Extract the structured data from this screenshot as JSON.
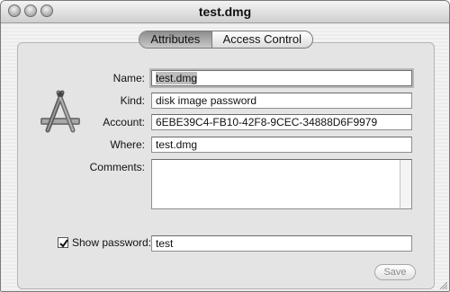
{
  "window": {
    "title": "test.dmg"
  },
  "tabs": [
    {
      "label": "Attributes",
      "selected": true
    },
    {
      "label": "Access Control",
      "selected": false
    }
  ],
  "form": {
    "name": {
      "label": "Name:",
      "value": "test.dmg"
    },
    "kind": {
      "label": "Kind:",
      "value": "disk image password"
    },
    "account": {
      "label": "Account:",
      "value": "6EBE39C4-FB10-42F8-9CEC-34888D6F9979"
    },
    "where": {
      "label": "Where:",
      "value": "test.dmg"
    },
    "comments": {
      "label": "Comments:",
      "value": ""
    },
    "show_password": {
      "label": "Show password:",
      "checked": true,
      "value": "test"
    }
  },
  "buttons": {
    "save": "Save"
  },
  "icons": [
    "close-icon",
    "minimize-icon",
    "zoom-icon",
    "app-store-icon",
    "checkbox-check-icon",
    "resize-grip-icon"
  ]
}
